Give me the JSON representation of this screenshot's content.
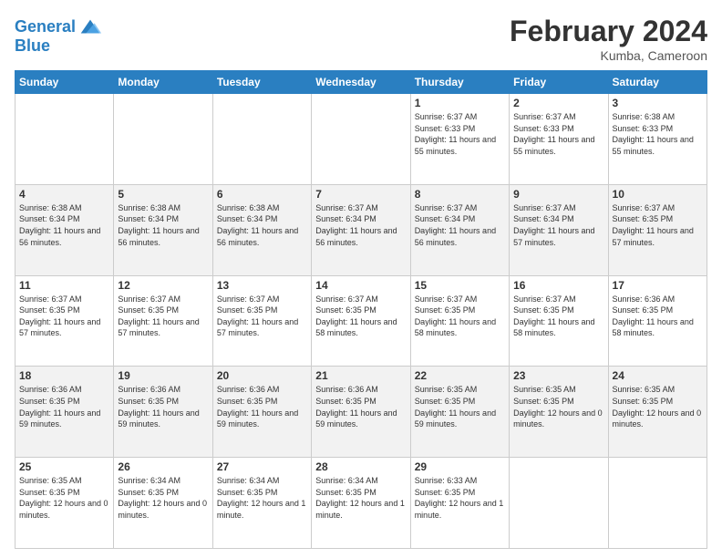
{
  "logo": {
    "line1": "General",
    "line2": "Blue"
  },
  "title": "February 2024",
  "subtitle": "Kumba, Cameroon",
  "days_of_week": [
    "Sunday",
    "Monday",
    "Tuesday",
    "Wednesday",
    "Thursday",
    "Friday",
    "Saturday"
  ],
  "weeks": [
    [
      {
        "day": "",
        "info": ""
      },
      {
        "day": "",
        "info": ""
      },
      {
        "day": "",
        "info": ""
      },
      {
        "day": "",
        "info": ""
      },
      {
        "day": "1",
        "info": "Sunrise: 6:37 AM\nSunset: 6:33 PM\nDaylight: 11 hours and 55 minutes."
      },
      {
        "day": "2",
        "info": "Sunrise: 6:37 AM\nSunset: 6:33 PM\nDaylight: 11 hours and 55 minutes."
      },
      {
        "day": "3",
        "info": "Sunrise: 6:38 AM\nSunset: 6:33 PM\nDaylight: 11 hours and 55 minutes."
      }
    ],
    [
      {
        "day": "4",
        "info": "Sunrise: 6:38 AM\nSunset: 6:34 PM\nDaylight: 11 hours and 56 minutes."
      },
      {
        "day": "5",
        "info": "Sunrise: 6:38 AM\nSunset: 6:34 PM\nDaylight: 11 hours and 56 minutes."
      },
      {
        "day": "6",
        "info": "Sunrise: 6:38 AM\nSunset: 6:34 PM\nDaylight: 11 hours and 56 minutes."
      },
      {
        "day": "7",
        "info": "Sunrise: 6:37 AM\nSunset: 6:34 PM\nDaylight: 11 hours and 56 minutes."
      },
      {
        "day": "8",
        "info": "Sunrise: 6:37 AM\nSunset: 6:34 PM\nDaylight: 11 hours and 56 minutes."
      },
      {
        "day": "9",
        "info": "Sunrise: 6:37 AM\nSunset: 6:34 PM\nDaylight: 11 hours and 57 minutes."
      },
      {
        "day": "10",
        "info": "Sunrise: 6:37 AM\nSunset: 6:35 PM\nDaylight: 11 hours and 57 minutes."
      }
    ],
    [
      {
        "day": "11",
        "info": "Sunrise: 6:37 AM\nSunset: 6:35 PM\nDaylight: 11 hours and 57 minutes."
      },
      {
        "day": "12",
        "info": "Sunrise: 6:37 AM\nSunset: 6:35 PM\nDaylight: 11 hours and 57 minutes."
      },
      {
        "day": "13",
        "info": "Sunrise: 6:37 AM\nSunset: 6:35 PM\nDaylight: 11 hours and 57 minutes."
      },
      {
        "day": "14",
        "info": "Sunrise: 6:37 AM\nSunset: 6:35 PM\nDaylight: 11 hours and 58 minutes."
      },
      {
        "day": "15",
        "info": "Sunrise: 6:37 AM\nSunset: 6:35 PM\nDaylight: 11 hours and 58 minutes."
      },
      {
        "day": "16",
        "info": "Sunrise: 6:37 AM\nSunset: 6:35 PM\nDaylight: 11 hours and 58 minutes."
      },
      {
        "day": "17",
        "info": "Sunrise: 6:36 AM\nSunset: 6:35 PM\nDaylight: 11 hours and 58 minutes."
      }
    ],
    [
      {
        "day": "18",
        "info": "Sunrise: 6:36 AM\nSunset: 6:35 PM\nDaylight: 11 hours and 59 minutes."
      },
      {
        "day": "19",
        "info": "Sunrise: 6:36 AM\nSunset: 6:35 PM\nDaylight: 11 hours and 59 minutes."
      },
      {
        "day": "20",
        "info": "Sunrise: 6:36 AM\nSunset: 6:35 PM\nDaylight: 11 hours and 59 minutes."
      },
      {
        "day": "21",
        "info": "Sunrise: 6:36 AM\nSunset: 6:35 PM\nDaylight: 11 hours and 59 minutes."
      },
      {
        "day": "22",
        "info": "Sunrise: 6:35 AM\nSunset: 6:35 PM\nDaylight: 11 hours and 59 minutes."
      },
      {
        "day": "23",
        "info": "Sunrise: 6:35 AM\nSunset: 6:35 PM\nDaylight: 12 hours and 0 minutes."
      },
      {
        "day": "24",
        "info": "Sunrise: 6:35 AM\nSunset: 6:35 PM\nDaylight: 12 hours and 0 minutes."
      }
    ],
    [
      {
        "day": "25",
        "info": "Sunrise: 6:35 AM\nSunset: 6:35 PM\nDaylight: 12 hours and 0 minutes."
      },
      {
        "day": "26",
        "info": "Sunrise: 6:34 AM\nSunset: 6:35 PM\nDaylight: 12 hours and 0 minutes."
      },
      {
        "day": "27",
        "info": "Sunrise: 6:34 AM\nSunset: 6:35 PM\nDaylight: 12 hours and 1 minute."
      },
      {
        "day": "28",
        "info": "Sunrise: 6:34 AM\nSunset: 6:35 PM\nDaylight: 12 hours and 1 minute."
      },
      {
        "day": "29",
        "info": "Sunrise: 6:33 AM\nSunset: 6:35 PM\nDaylight: 12 hours and 1 minute."
      },
      {
        "day": "",
        "info": ""
      },
      {
        "day": "",
        "info": ""
      }
    ]
  ]
}
